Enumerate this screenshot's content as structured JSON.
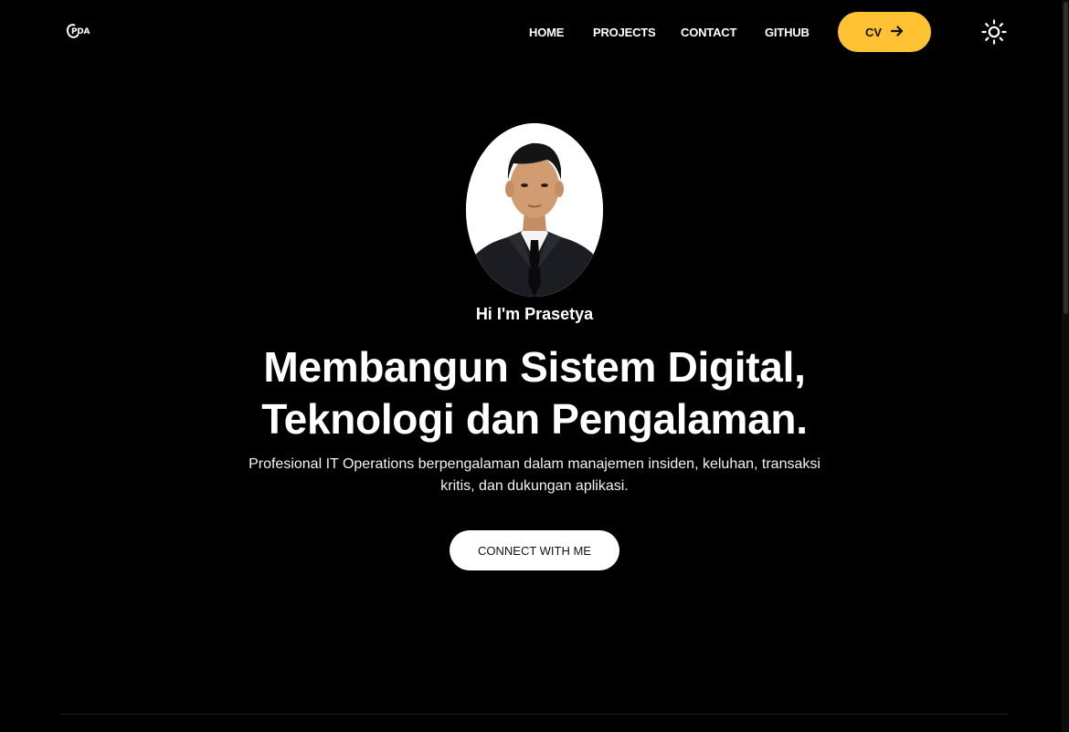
{
  "header": {
    "logo_text": "PDA",
    "nav": {
      "home": "HOME",
      "projects": "PROJECTS",
      "contact": "CONTACT",
      "github": "GITHUB"
    },
    "cv_label": "CV",
    "cv_icon": "arrow-right-icon",
    "theme_icon": "sun-icon"
  },
  "hero": {
    "greeting": "Hi I'm Prasetya",
    "headline_line1": "Membangun Sistem Digital,",
    "headline_line2": "Teknologi dan Pengalaman.",
    "subtitle": "Profesional IT Operations berpengalaman dalam manajemen insiden, keluhan, transaksi kritis, dan dukungan aplikasi.",
    "connect_label": "CONNECT WITH ME"
  },
  "colors": {
    "background": "#000000",
    "accent": "#ffc233",
    "text": "#ffffff"
  }
}
